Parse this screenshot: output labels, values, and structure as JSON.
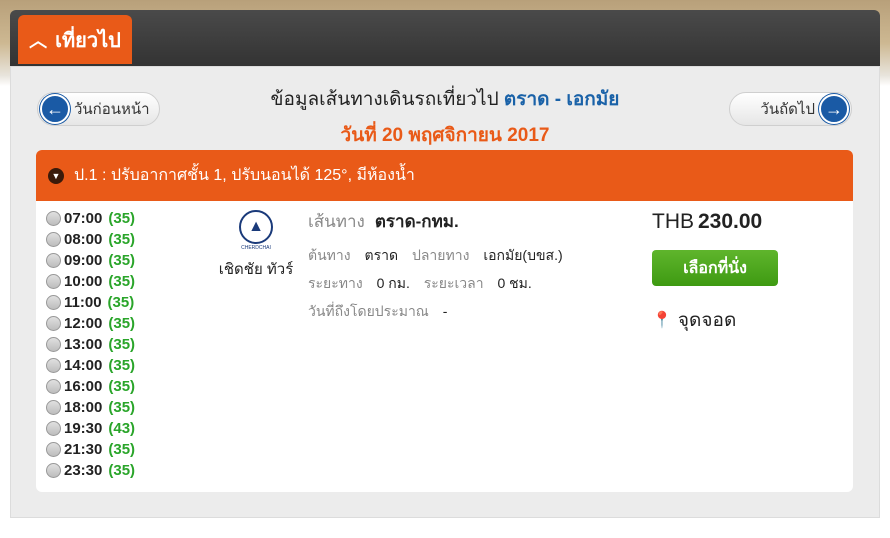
{
  "tab": {
    "label": "เที่ยวไป"
  },
  "nav": {
    "prev_label": "วันก่อนหน้า",
    "next_label": "วันถัดไป"
  },
  "heading": {
    "prefix": "ข้อมูลเส้นทางเดินรถเที่ยวไป",
    "route": "ตราด - เอกมัย",
    "date": "วันที่ 20 พฤศจิกายน 2017"
  },
  "bus": {
    "header": "ป.1 : ปรับอากาศชั้น 1, ปรับนอนได้ 125°, มีห้องน้ำ",
    "times": [
      {
        "time": "07:00",
        "seats": "(35)"
      },
      {
        "time": "08:00",
        "seats": "(35)"
      },
      {
        "time": "09:00",
        "seats": "(35)"
      },
      {
        "time": "10:00",
        "seats": "(35)"
      },
      {
        "time": "11:00",
        "seats": "(35)"
      },
      {
        "time": "12:00",
        "seats": "(35)"
      },
      {
        "time": "13:00",
        "seats": "(35)"
      },
      {
        "time": "14:00",
        "seats": "(35)"
      },
      {
        "time": "16:00",
        "seats": "(35)"
      },
      {
        "time": "18:00",
        "seats": "(35)"
      },
      {
        "time": "19:30",
        "seats": "(43)"
      },
      {
        "time": "21:30",
        "seats": "(35)"
      },
      {
        "time": "23:30",
        "seats": "(35)"
      }
    ],
    "operator": {
      "logo_text": "CHERDCHAI",
      "name": "เชิดชัย ทัวร์"
    },
    "info": {
      "route_label": "เส้นทาง",
      "route_value": "ตราด-กทม.",
      "origin_label": "ต้นทาง",
      "origin_value": "ตราด",
      "dest_label": "ปลายทาง",
      "dest_value": "เอกมัย(บขส.)",
      "distance_label": "ระยะทาง",
      "distance_value": "0 กม.",
      "duration_label": "ระยะเวลา",
      "duration_value": "0 ชม.",
      "arrival_label": "วันที่ถึงโดยประมาณ",
      "arrival_value": "-"
    },
    "price": {
      "currency": "THB",
      "amount": "230.00"
    },
    "select_label": "เลือกที่นั่ง",
    "stops_label": "จุดจอด"
  }
}
